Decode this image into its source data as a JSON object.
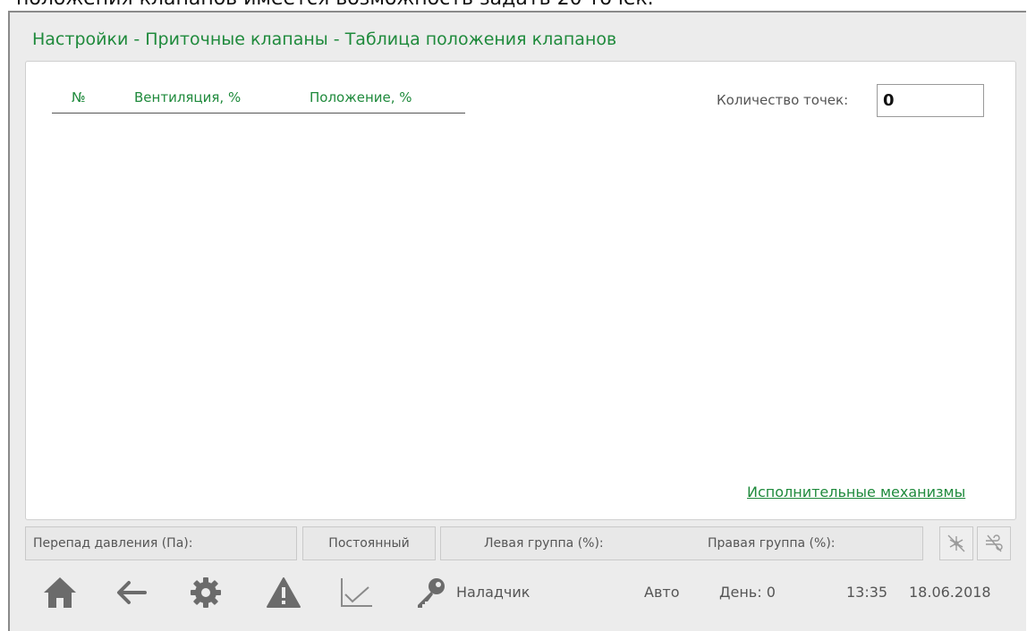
{
  "cut_caption": "положения клапанов имеется возможность задать 20 точек.",
  "title": "Настройки - Приточные клапаны - Таблица положения клапанов",
  "table": {
    "columns": [
      "№",
      "Вентиляция, %",
      "Положение, %"
    ],
    "rows": []
  },
  "points": {
    "label": "Количество точек:",
    "value": "0"
  },
  "link": "Исполнительные механизмы",
  "status_bar": {
    "pressure": "Перепад давления (Па):",
    "mode": "Постоянный",
    "left_group": "Левая группа (%):",
    "right_group": "Правая группа (%):"
  },
  "icons": {
    "fan_off": "fan-off-icon",
    "wind_off": "wind-off-icon",
    "home": "home-icon",
    "back": "arrow-left-icon",
    "settings": "gear-icon",
    "alarm": "warning-icon",
    "trend": "chart-line-icon",
    "user": "key-icon"
  },
  "footer": {
    "user": "Наладчик",
    "mode": "Авто",
    "day": "День: 0",
    "time": "13:35",
    "date": "18.06.2018"
  },
  "colors": {
    "accent": "#1f8a3c",
    "icon": "#6b6b6b"
  }
}
